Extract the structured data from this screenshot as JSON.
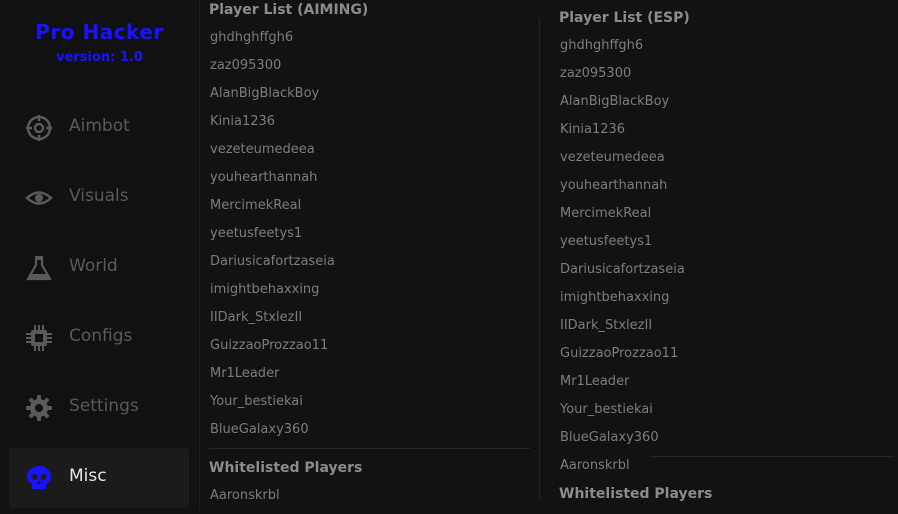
{
  "brand": {
    "title": "Pro Hacker",
    "version": "version: 1.0",
    "accent_color": "#1a12ff"
  },
  "nav": {
    "items": [
      {
        "label": "Aimbot",
        "icon": "crosshair-icon"
      },
      {
        "label": "Visuals",
        "icon": "eye-icon"
      },
      {
        "label": "World",
        "icon": "flask-icon"
      },
      {
        "label": "Configs",
        "icon": "chip-icon"
      },
      {
        "label": "Settings",
        "icon": "gear-icon"
      },
      {
        "label": "Misc",
        "icon": "skull-icon",
        "active": true
      }
    ]
  },
  "aiming": {
    "heading": "Player List (AIMING)",
    "players": [
      "ghdhghffgh6",
      "zaz095300",
      "AlanBigBlackBoy",
      "Kinia1236",
      "vezeteumedeea",
      "youhearthannah",
      "MercimekReal",
      "yeetusfeetys1",
      "Dariusicafortzaseia",
      "imightbehaxxing",
      "IIDark_StxlezII",
      "GuizzaoProzzao11",
      "Mr1Leader",
      "Your_bestiekai",
      "BlueGalaxy360"
    ],
    "whitelist_heading": "Whitelisted Players",
    "whitelist": [
      "Aaronskrbl"
    ]
  },
  "esp": {
    "heading": "Player List (ESP)",
    "players": [
      "ghdhghffgh6",
      "zaz095300",
      "AlanBigBlackBoy",
      "Kinia1236",
      "vezeteumedeea",
      "youhearthannah",
      "MercimekReal",
      "yeetusfeetys1",
      "Dariusicafortzaseia",
      "imightbehaxxing",
      "IIDark_StxlezII",
      "GuizzaoProzzao11",
      "Mr1Leader",
      "Your_bestiekai",
      "BlueGalaxy360",
      "Aaronskrbl"
    ],
    "whitelist_heading": "Whitelisted Players"
  }
}
